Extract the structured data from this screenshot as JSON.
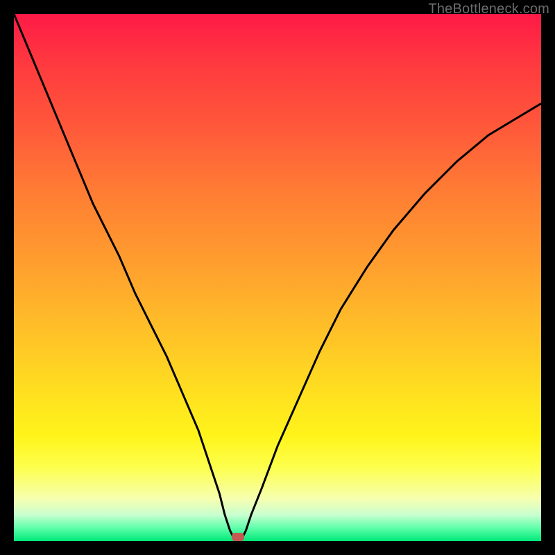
{
  "watermark": "TheBottleneck.com",
  "marker": {
    "x_pct": 42.5,
    "y_pct": 99.0
  },
  "colors": {
    "frame": "#000000",
    "curve": "#000000",
    "marker": "#c75a52",
    "gradient_top": "#ff1a47",
    "gradient_bottom": "#00e878"
  },
  "chart_data": {
    "type": "line",
    "title": "",
    "xlabel": "",
    "ylabel": "",
    "xlim": [
      0,
      100
    ],
    "ylim": [
      0,
      100
    ],
    "grid": false,
    "legend": false,
    "series": [
      {
        "name": "bottleneck-curve",
        "x": [
          0,
          5,
          10,
          15,
          20,
          23,
          26,
          29,
          32,
          35,
          37,
          39,
          40,
          41,
          42,
          43,
          44,
          45,
          47,
          50,
          54,
          58,
          62,
          67,
          72,
          78,
          84,
          90,
          95,
          100
        ],
        "values": [
          100,
          88,
          76,
          64,
          54,
          47,
          41,
          35,
          28,
          21,
          15,
          9,
          5,
          2,
          0,
          0,
          2,
          5,
          10,
          18,
          27,
          36,
          44,
          52,
          59,
          66,
          72,
          77,
          80,
          83
        ]
      }
    ],
    "annotations": [
      {
        "type": "marker",
        "x": 42.5,
        "y": 0.5,
        "label": "optimal-point"
      }
    ],
    "notes": "Axis ticks and numeric labels are not shown in the image; x and y are expressed as 0–100 percentages of the plot area. values = vertical position from bottom (0 = bottom green band, 100 = top)."
  }
}
